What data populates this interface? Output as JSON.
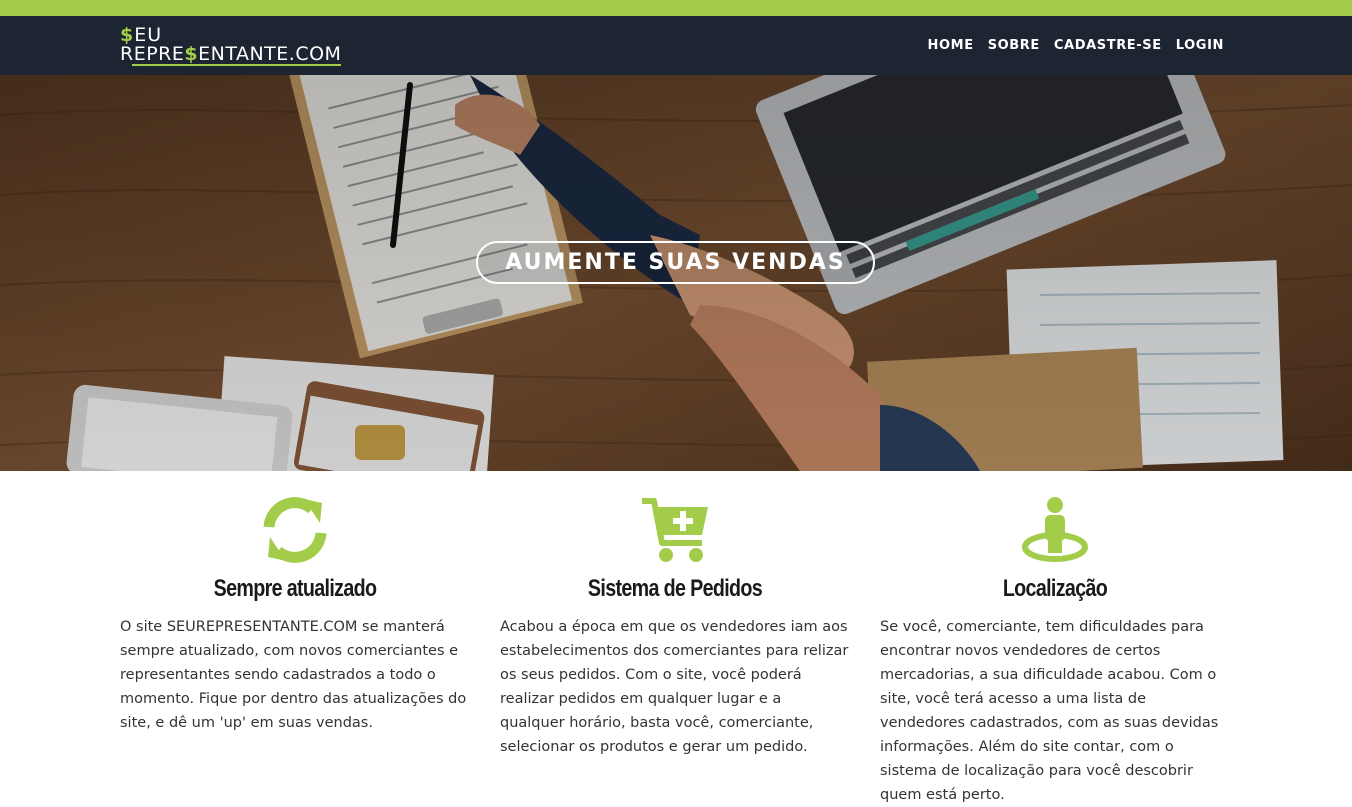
{
  "brand": {
    "line1_symbol": "$",
    "line1_text": "EU",
    "line2_prefix": "REPRE",
    "line2_symbol": "$",
    "line2_suffix": "ENTANTE.COM"
  },
  "nav": {
    "items": [
      "HOME",
      "SOBRE",
      "CADASTRE-SE",
      "LOGIN"
    ]
  },
  "hero": {
    "title": "AUMENTE SUAS VENDAS"
  },
  "features": [
    {
      "icon": "refresh-icon",
      "title": "Sempre atualizado",
      "text": "O site SEUREPRESENTANTE.COM se manterá sempre atualizado, com novos comerciantes e representantes sendo cadastrados a todo o momento. Fique por dentro das atualizações do site, e dê um 'up' em suas vendas."
    },
    {
      "icon": "cart-plus-icon",
      "title": "Sistema de Pedidos",
      "text": "Acabou a época em que os vendedores iam aos estabelecimentos dos comerciantes para relizar os seus pedidos. Com o site, você poderá realizar pedidos em qualquer lugar e a qualquer horário, basta você, comerciante, selecionar os produtos e gerar um pedido."
    },
    {
      "icon": "location-person-icon",
      "title": "Localização",
      "text": "Se você, comerciante, tem dificuldades para encontrar novos vendedores de certos mercadorias, a sua dificuldade acabou. Com o site, você terá acesso a uma lista de vendedores cadastrados, com as suas devidas informações. Além do site contar, com o sistema de localização para você descobrir quem está perto."
    }
  ],
  "colors": {
    "accent": "#a3cc4a",
    "navbar": "#1d2533"
  }
}
